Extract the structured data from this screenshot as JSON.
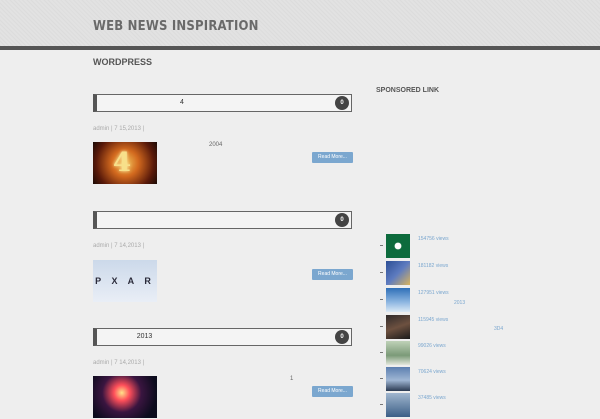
{
  "header": {
    "site_title": "WEB NEWS INSPIRATION"
  },
  "category": "WORDPRESS",
  "posts": [
    {
      "title": "4",
      "comments": "0",
      "meta": "admin  |   7    15,2013  |",
      "excerpt": "2004",
      "read_more": "Read More..."
    },
    {
      "title": "",
      "comments": "0",
      "meta": "admin  |   7    14,2013  |",
      "excerpt": "",
      "read_more": "Read More...",
      "thumb_text": "P  X  A  R"
    },
    {
      "title": "2013",
      "comments": "0",
      "meta": "admin  |   7    14,2013  |",
      "excerpt": "1",
      "read_more": "Read More..."
    }
  ],
  "sidebar": {
    "heading": "SPONSORED LINK",
    "popular": [
      {
        "views": "154756 views"
      },
      {
        "views": "181182 views"
      },
      {
        "views": "127951 views",
        "extra": "2013"
      },
      {
        "views": "115945 views",
        "extra": "3D4"
      },
      {
        "views": "99026 views"
      },
      {
        "views": "70624 views"
      },
      {
        "views": "37485 views"
      }
    ]
  },
  "colors": {
    "accent": "#7ba7cf",
    "header_bar": "#555555",
    "background": "#eeeeee"
  }
}
